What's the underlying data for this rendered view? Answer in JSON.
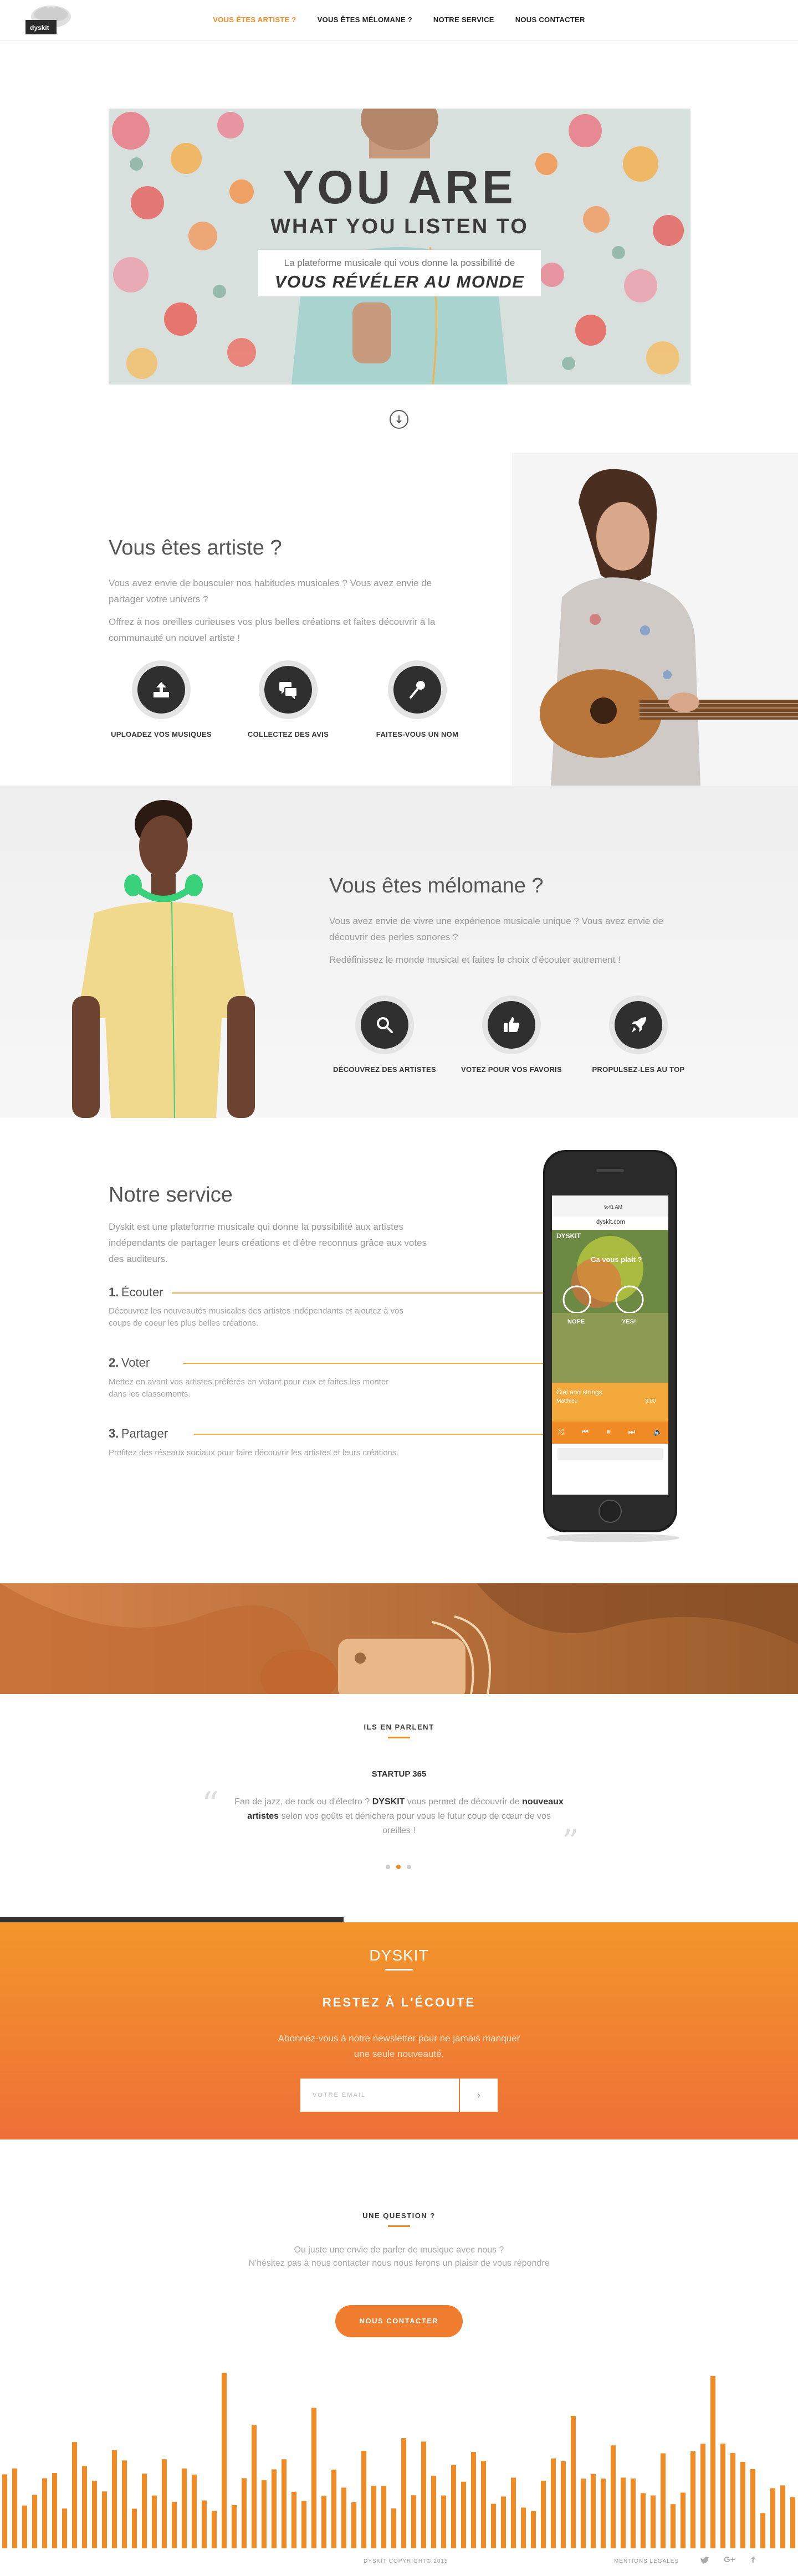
{
  "nav": {
    "logo_text": "dyskit",
    "links": [
      {
        "label": "VOUS ÊTES ARTISTE ?",
        "active": true
      },
      {
        "label": "VOUS ÊTES MÉLOMANE ?",
        "active": false
      },
      {
        "label": "NOTRE SERVICE",
        "active": false
      },
      {
        "label": "NOUS CONTACTER",
        "active": false
      }
    ]
  },
  "hero": {
    "title_line1": "YOU ARE",
    "title_line2": "WHAT YOU LISTEN TO",
    "subtitle": "La plateforme musicale qui vous donne la possibilité de",
    "tagline": "VOUS RÉVÉLER AU MONDE"
  },
  "artist": {
    "title": "Vous êtes artiste ?",
    "para1": "Vous avez envie de bousculer nos habitudes musicales ? Vous avez envie de partager votre univers ?",
    "para2": "Offrez à nos oreilles curieuses vos plus belles créations et faites découvrir à la communauté un nouvel artiste !",
    "features": [
      {
        "icon": "upload-icon",
        "label": "UPLOADEZ VOS MUSIQUES"
      },
      {
        "icon": "chat-icon",
        "label": "COLLECTEZ DES AVIS"
      },
      {
        "icon": "microphone-icon",
        "label": "FAITES-VOUS UN NOM"
      }
    ]
  },
  "melomane": {
    "title": "Vous êtes mélomane ?",
    "para1": "Vous avez envie de vivre une expérience musicale unique ? Vous avez envie de découvrir des perles sonores ?",
    "para2": "Redéfinissez le monde musical et faites le choix d'écouter autrement !",
    "features": [
      {
        "icon": "search-icon",
        "label": "DÉCOUVREZ DES ARTISTES"
      },
      {
        "icon": "thumbs-up-icon",
        "label": "VOTEZ POUR VOS FAVORIS"
      },
      {
        "icon": "rocket-icon",
        "label": "PROPULSEZ-LES AU TOP"
      }
    ]
  },
  "service": {
    "title": "Notre service",
    "intro": "Dyskit est une plateforme musicale qui donne la possibilité aux artistes indépendants de partager leurs créations et d'être reconnus grâce aux votes des auditeurs.",
    "steps": [
      {
        "num": "1.",
        "title": "Écouter",
        "desc": "Découvrez les nouveautés musicales des artistes indépendants et ajoutez à vos coups de coeur les plus belles créations."
      },
      {
        "num": "2.",
        "title": "Voter",
        "desc": "Mettez en avant vos artistes préférés en votant pour eux et faites les monter dans les classements."
      },
      {
        "num": "3.",
        "title": "Partager",
        "desc": "Profitez des réseaux sociaux pour faire découvrir les artistes et leurs créations."
      }
    ],
    "phone": {
      "url": "dyskit.com",
      "status_time": "9:41 AM",
      "app_name": "DYSKIT",
      "track": "Ca vous plait ?",
      "nope": "NOPE",
      "yes": "YES!",
      "now_playing": "Ciel and strings",
      "artist": "Matthieu",
      "duration": "3:00"
    }
  },
  "testimonials": {
    "heading": "ILS EN PARLENT",
    "source": "STARTUP 365",
    "quote_pre": "Fan de jazz, de rock ou d'électro ?",
    "brand": "DYSKIT",
    "quote_mid": "vous permet de découvrir de",
    "highlight": "nouveaux artistes",
    "quote_post": "selon vos goûts et dénichera pour vous le futur coup de cœur de vos oreilles !",
    "dots": 3,
    "active_dot": 1
  },
  "newsletter": {
    "brand": "DYSKIT",
    "heading": "RESTEZ À L'ÉCOUTE",
    "text": "Abonnez-vous à notre newsletter pour ne jamais manquer une seule nouveauté.",
    "placeholder": "VOTRE EMAIL"
  },
  "contact": {
    "heading": "UNE QUESTION ?",
    "line1": "Ou juste une envie de parler de musique avec nous ?",
    "line2": "N'hésitez pas à nous contacter nous nous ferons un plaisir de vous répondre",
    "button": "NOUS CONTACTER"
  },
  "footer": {
    "copyright": "DYSKIT COPYRIGHT© 2015",
    "legal": "MENTIONS LÉGALES",
    "social": [
      "twitter-icon",
      "google-plus-icon",
      "facebook-icon"
    ]
  },
  "colors": {
    "accent": "#f08a24",
    "dark": "#2f2f2f",
    "newsletter_top": "#f2962b",
    "newsletter_bottom": "#ee6f37"
  }
}
